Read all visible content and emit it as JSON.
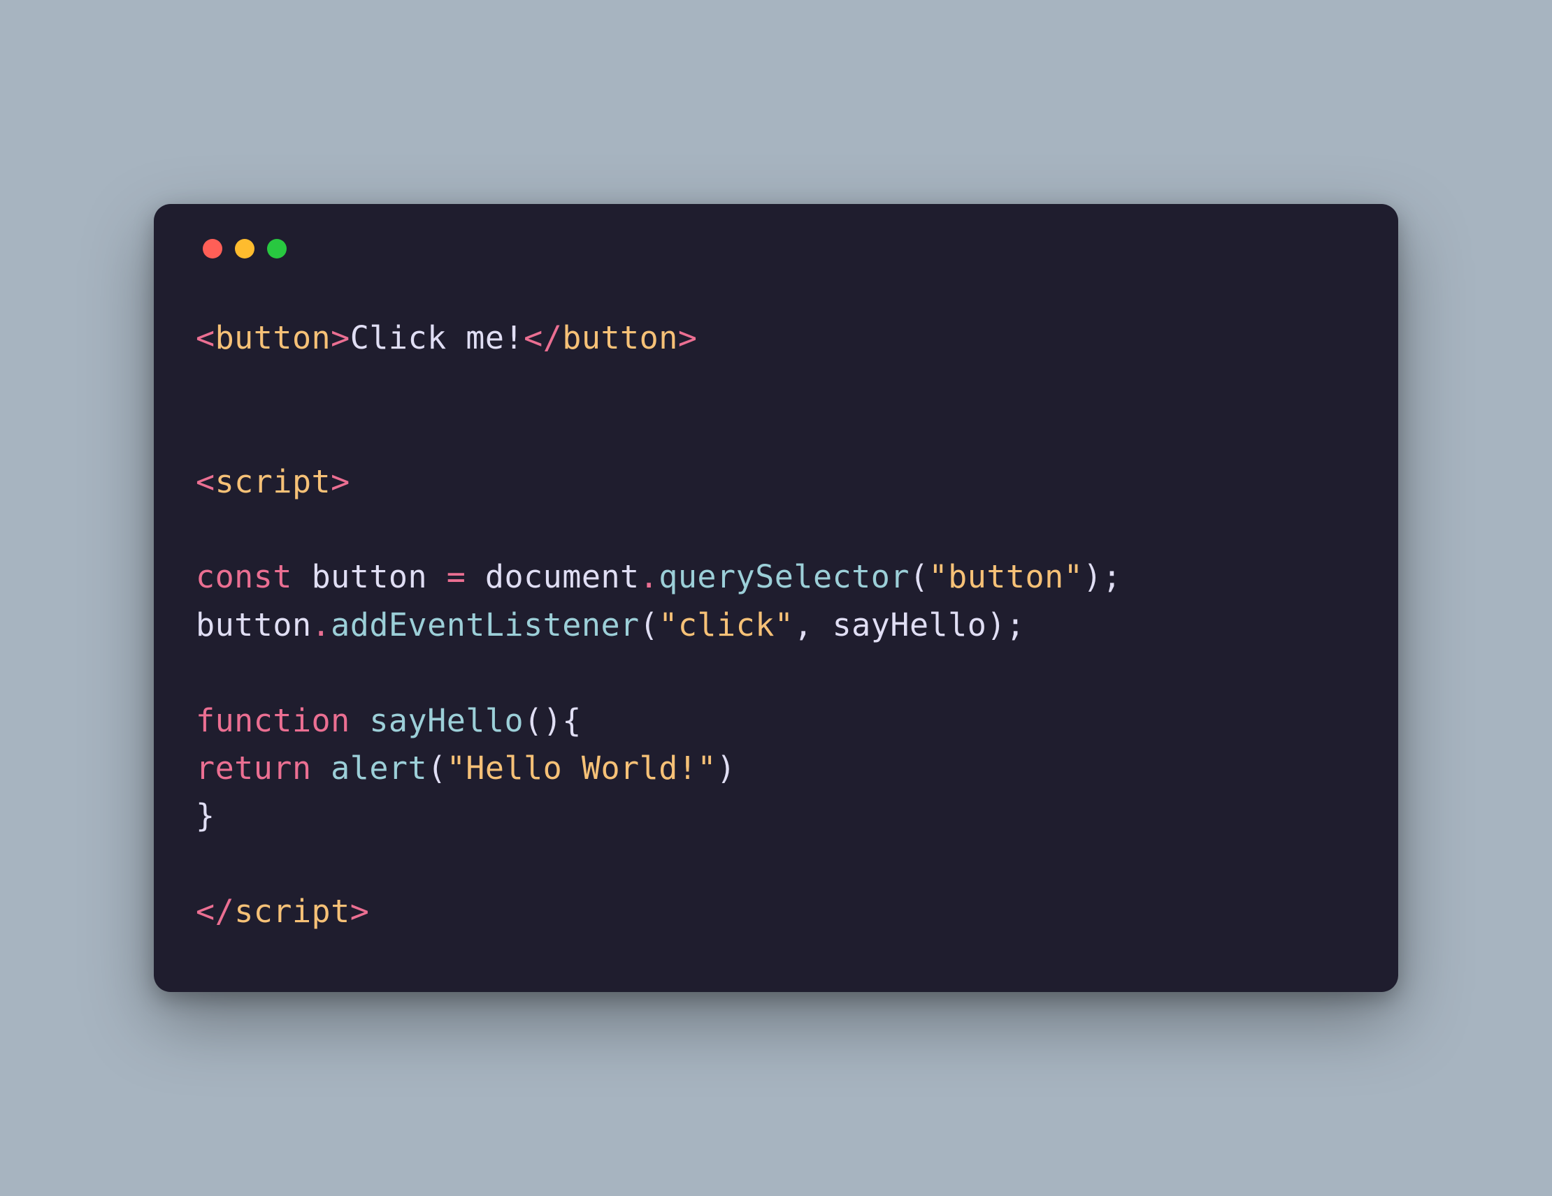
{
  "trafficLights": {
    "red": "close",
    "yellow": "minimize",
    "green": "maximize"
  },
  "code": {
    "lt": "<",
    "gt": ">",
    "slash": "/",
    "button_tag": "button",
    "button_text": "Click me!",
    "script_tag": "script",
    "const_kw": "const",
    "space": " ",
    "button_var": "button",
    "equals": " = ",
    "document_obj": "document",
    "dot": ".",
    "querySelector_fn": "querySelector",
    "openParen": "(",
    "closeParen": ")",
    "button_str": "\"button\"",
    "semicolon": ";",
    "addEventListener_fn": "addEventListener",
    "click_str": "\"click\"",
    "comma_space": ", ",
    "sayHello_ref": "sayHello",
    "function_kw": "function",
    "sayHello_def": "sayHello",
    "openBrace": "{",
    "closeBrace": "}",
    "return_kw": "return",
    "alert_fn": "alert",
    "hello_str": "\"Hello World!\"",
    "empty_line": "",
    "blank2": "\n\n",
    "blank1": "\n"
  }
}
